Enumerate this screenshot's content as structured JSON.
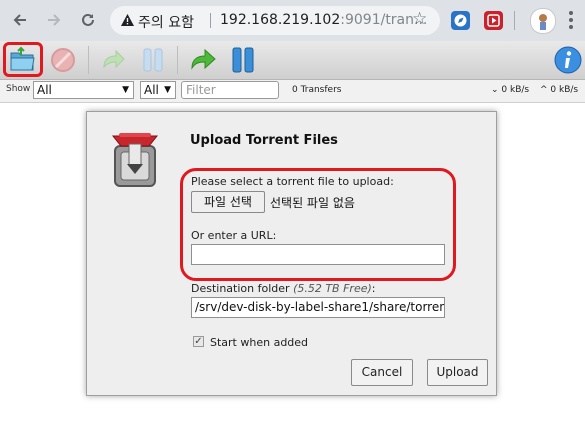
{
  "browser": {
    "security_warning": "주의 요함",
    "url_host": "192.168.219.102",
    "url_rest": ":9091/tran...",
    "colors": {
      "chrome_bg": "#dee1e6",
      "omnibox_bg": "#f1f3f4"
    }
  },
  "toolbar": {
    "buttons": [
      "open-torrent",
      "remove-torrent",
      "resume-selected",
      "pause-selected",
      "resume-all",
      "pause-all",
      "inspector"
    ],
    "highlight_color": "#e01820"
  },
  "filterbar": {
    "show_label": "Show",
    "state_filter": "All",
    "tracker_filter": "All",
    "filter_placeholder": "Filter",
    "transfers_count": "0 Transfers",
    "download_speed": "0 kB/s",
    "upload_speed": "0 kB/s"
  },
  "dialog": {
    "title": "Upload Torrent Files",
    "file_prompt": "Please select a torrent file to upload:",
    "file_button": "파일 선택",
    "file_status": "선택된 파일 없음",
    "url_prompt": "Or enter a URL:",
    "url_value": "",
    "destination_label": "Destination folder",
    "free_space": "(5.52 TB Free)",
    "destination_suffix": ":",
    "destination_value": "/srv/dev-disk-by-label-share1/share/torren",
    "start_when_added_label": "Start when added",
    "start_when_added_checked": true,
    "cancel_label": "Cancel",
    "upload_label": "Upload"
  }
}
